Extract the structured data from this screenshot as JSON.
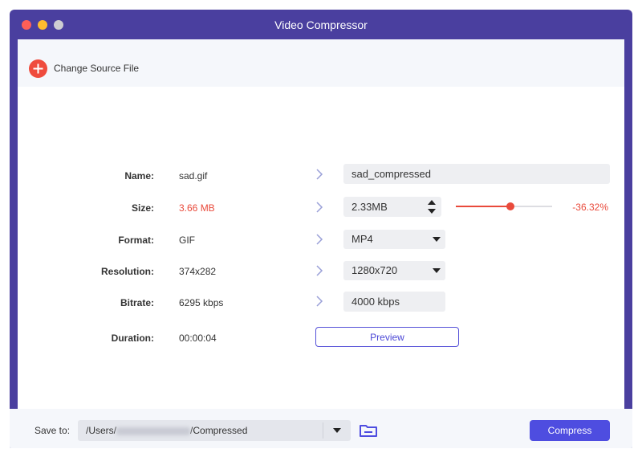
{
  "window": {
    "title": "Video Compressor"
  },
  "toolbar": {
    "change_source_label": "Change Source File"
  },
  "fields": {
    "name": {
      "label": "Name:",
      "source": "sad.gif",
      "output": "sad_compressed"
    },
    "size": {
      "label": "Size:",
      "source": "3.66 MB",
      "output": "2.33MB",
      "percent": "-36.32%",
      "slider_fraction": 0.57
    },
    "format": {
      "label": "Format:",
      "source": "GIF",
      "output": "MP4"
    },
    "resolution": {
      "label": "Resolution:",
      "source": "374x282",
      "output": "1280x720"
    },
    "bitrate": {
      "label": "Bitrate:",
      "source": "6295 kbps",
      "output": "4000 kbps"
    },
    "duration": {
      "label": "Duration:",
      "source": "00:00:04"
    }
  },
  "preview_label": "Preview",
  "footer": {
    "save_label": "Save to:",
    "path_prefix": "/Users/",
    "path_suffix": "/Compressed",
    "compress_label": "Compress"
  },
  "colors": {
    "accent": "#4e4de0",
    "danger": "#e94a3b",
    "frame": "#4a3f9f"
  }
}
